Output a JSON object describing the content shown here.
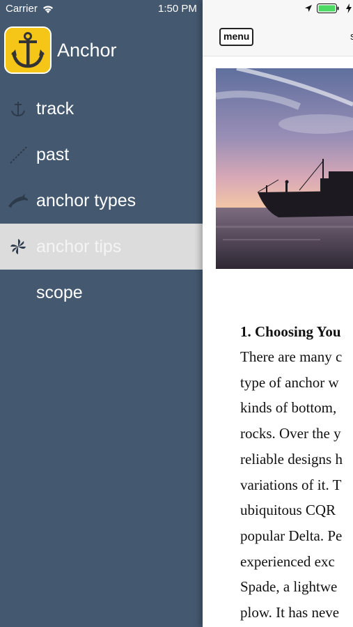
{
  "status": {
    "carrier": "Carrier",
    "time": "1:50 PM"
  },
  "app": {
    "title": "Anchor"
  },
  "nav": [
    {
      "label": "track",
      "icon": "anchor-outline-icon"
    },
    {
      "label": "past",
      "icon": "chain-icon"
    },
    {
      "label": "anchor types",
      "icon": "dolphin-icon"
    },
    {
      "label": "anchor tips",
      "icon": "pinwheel-icon",
      "active": true
    },
    {
      "label": "scope",
      "icon": ""
    }
  ],
  "content": {
    "menu_label": "menu",
    "nav_title_fragment": "s",
    "article_heading": "1. Choosing You",
    "article_lines": [
      "There are many c",
      "type of anchor w",
      "kinds of bottom,",
      "rocks. Over the y",
      "reliable designs h",
      "variations of it. T",
      "ubiquitous CQR",
      "popular Delta. Pe",
      "experienced exc",
      "Spade, a lightwe",
      "plow. It has neve"
    ]
  },
  "colors": {
    "sidebar": "#44586f",
    "active_item": "#dcdcdc",
    "app_icon": "#f5c518",
    "battery": "#4cd964"
  }
}
